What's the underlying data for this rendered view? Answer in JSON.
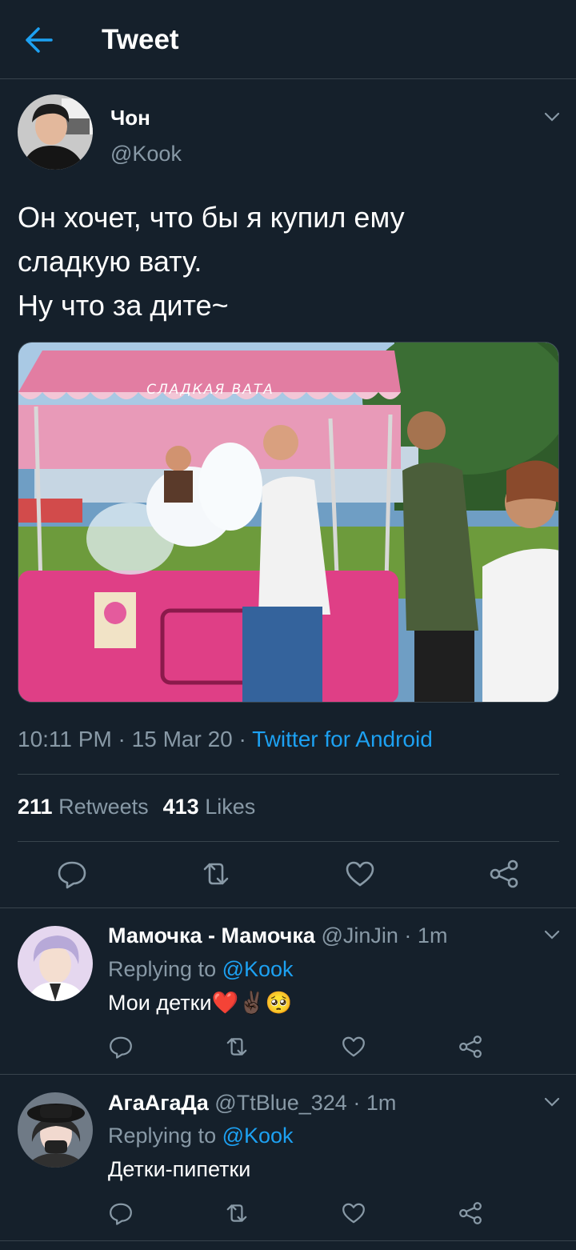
{
  "header": {
    "title": "Tweet"
  },
  "tweet": {
    "author_name": "Чон",
    "author_handle": "@Kook",
    "text": "Он хочет, что бы я купил ему\nсладкую вату.\nНу что за дите~",
    "image_sign": "СЛАДКАЯ ВАТА",
    "time": "10:11 PM",
    "date": "15 Mar 20",
    "client": "Twitter for Android",
    "retweets_count": "211",
    "retweets_label": "Retweets",
    "likes_count": "413",
    "likes_label": "Likes"
  },
  "replies": [
    {
      "name": "Мамочка - Мамочка",
      "handle": "@JinJin",
      "time": "1m",
      "replying_prefix": "Replying to",
      "replying_to": "@Kook",
      "text": "Мои детки❤️✌🏿🥺"
    },
    {
      "name": "АгаАгаДа",
      "handle": "@TtBlue_324",
      "time": "1m",
      "replying_prefix": "Replying to",
      "replying_to": "@Kook",
      "text": "Детки-пипетки"
    }
  ],
  "colors": {
    "background": "#15202b",
    "accent": "#1da1f2",
    "secondary_text": "#8899a6",
    "divider": "#38444d"
  }
}
